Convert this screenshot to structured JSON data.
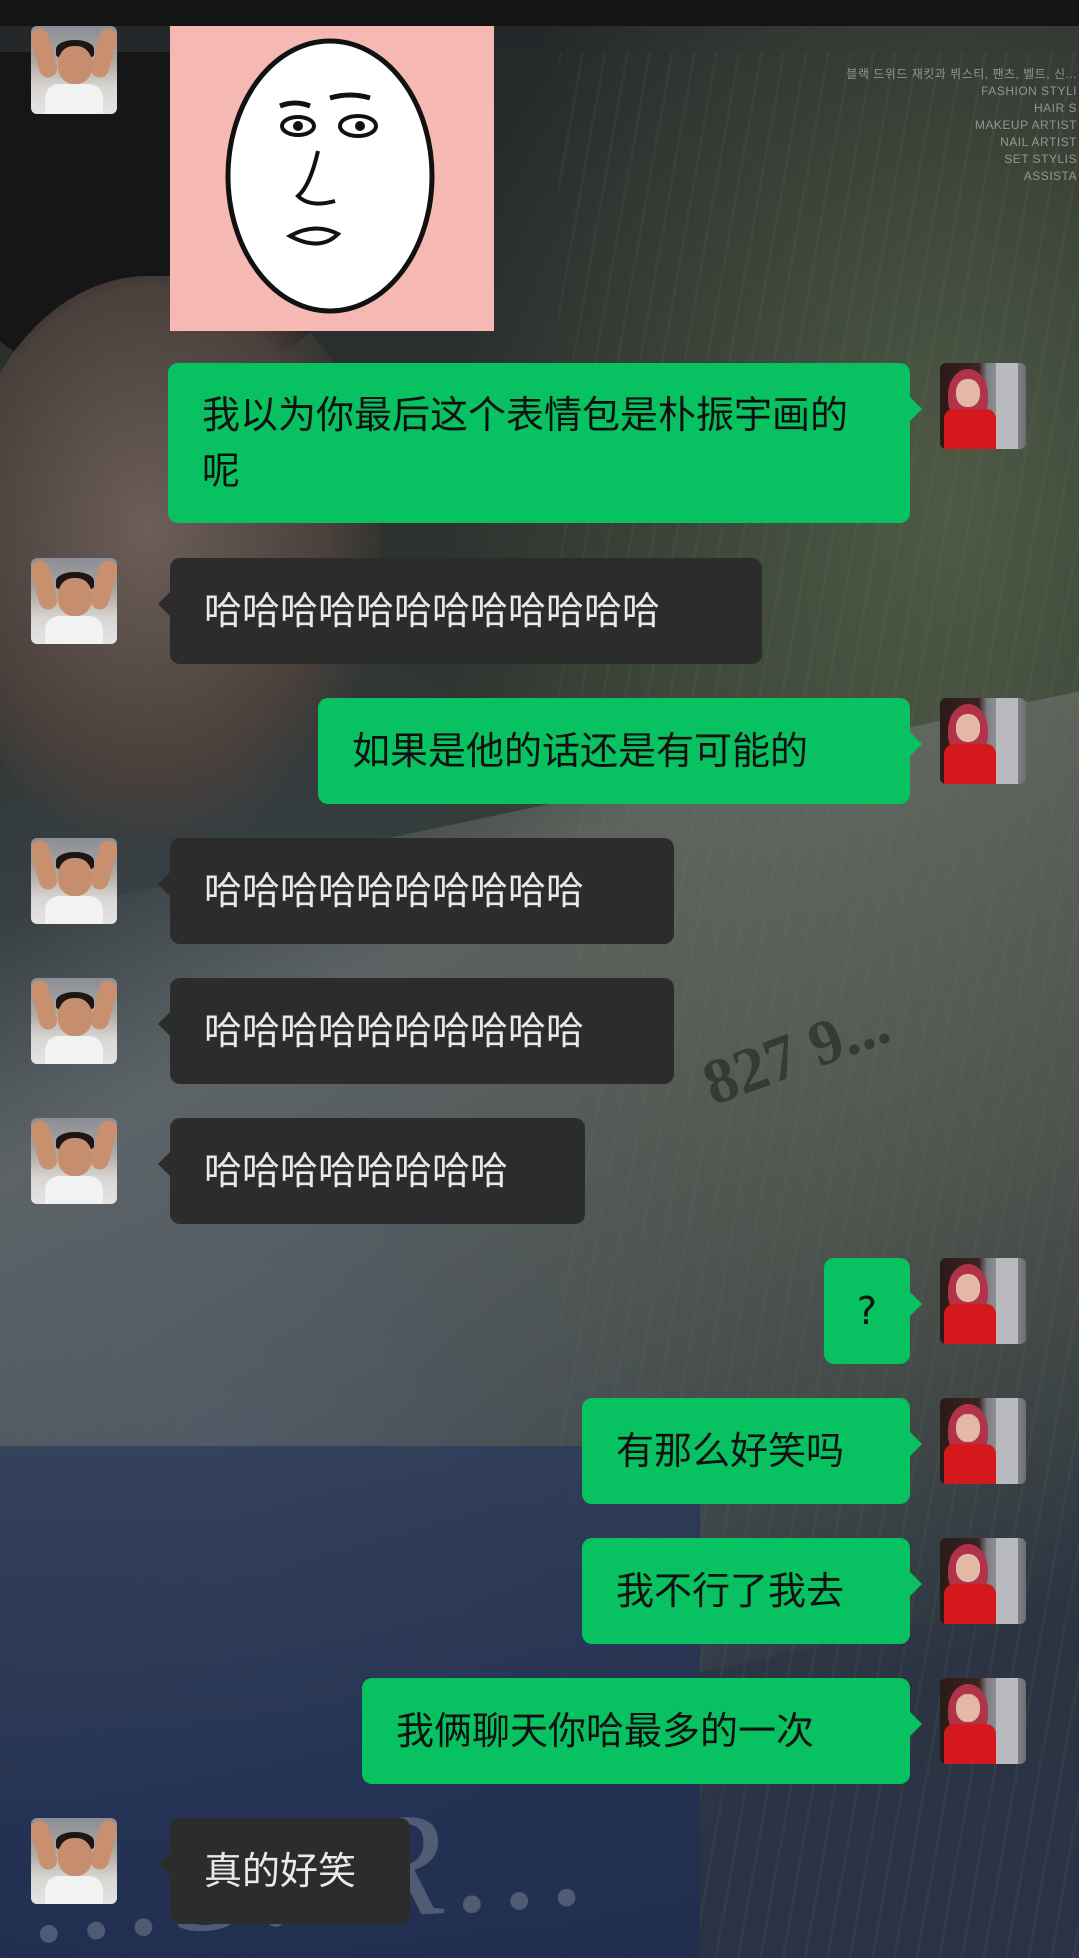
{
  "wallpaper": {
    "credits": [
      "블랙 드위드 재킷과 뷔스티, 팬츠, 벨트, 신...",
      "FASHION STYLI",
      "HAIR S",
      "MAKEUP ARTIST",
      "NAIL ARTIST",
      "SET STYLIS",
      "ASSISTA"
    ],
    "headline": "827 9...",
    "script_text": "...S..R..."
  },
  "messages": [
    {
      "from": "friend",
      "type": "sticker",
      "sticker": "egg-face-meme"
    },
    {
      "from": "me",
      "text": "我以为你最后这个表情包是朴振宇画的呢"
    },
    {
      "from": "friend",
      "text": "哈哈哈哈哈哈哈哈哈哈哈哈"
    },
    {
      "from": "me",
      "text": "如果是他的话还是有可能的"
    },
    {
      "from": "friend",
      "text": "哈哈哈哈哈哈哈哈哈哈"
    },
    {
      "from": "friend",
      "text": "哈哈哈哈哈哈哈哈哈哈"
    },
    {
      "from": "friend",
      "text": "哈哈哈哈哈哈哈哈"
    },
    {
      "from": "me",
      "text": "?"
    },
    {
      "from": "me",
      "text": "有那么好笑吗"
    },
    {
      "from": "me",
      "text": "我不行了我去"
    },
    {
      "from": "me",
      "text": "我俩聊天你哈最多的一次"
    },
    {
      "from": "friend",
      "text": "真的好笑"
    }
  ],
  "colors": {
    "outgoing_bubble": "#08c160",
    "incoming_bubble": "#2c2c2c",
    "incoming_text": "#e9e9e9",
    "outgoing_text": "#111111"
  }
}
